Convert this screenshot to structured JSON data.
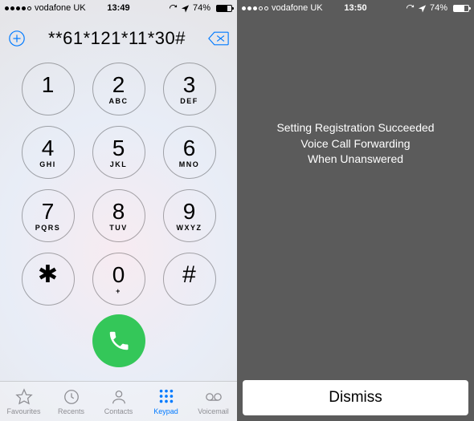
{
  "left": {
    "status": {
      "carrier": "vodafone UK",
      "time": "13:49",
      "battery_pct": "74%",
      "signal_filled": 4,
      "signal_total": 5
    },
    "dialed": "**61*121*11*30#",
    "keys": [
      {
        "num": "1",
        "sub": " "
      },
      {
        "num": "2",
        "sub": "ABC"
      },
      {
        "num": "3",
        "sub": "DEF"
      },
      {
        "num": "4",
        "sub": "GHI"
      },
      {
        "num": "5",
        "sub": "JKL"
      },
      {
        "num": "6",
        "sub": "MNO"
      },
      {
        "num": "7",
        "sub": "PQRS"
      },
      {
        "num": "8",
        "sub": "TUV"
      },
      {
        "num": "9",
        "sub": "WXYZ"
      },
      {
        "num": "✱",
        "sub": ""
      },
      {
        "num": "0",
        "sub": "+"
      },
      {
        "num": "#",
        "sub": ""
      }
    ],
    "tabs": {
      "favourites": "Favourites",
      "recents": "Recents",
      "contacts": "Contacts",
      "keypad": "Keypad",
      "voicemail": "Voicemail"
    }
  },
  "right": {
    "status": {
      "carrier": "vodafone UK",
      "time": "13:50",
      "battery_pct": "74%",
      "signal_filled": 3,
      "signal_total": 5
    },
    "message": {
      "line1": "Setting Registration Succeeded",
      "line2": "Voice Call Forwarding",
      "line3": "When Unanswered"
    },
    "dismiss": "Dismiss"
  }
}
